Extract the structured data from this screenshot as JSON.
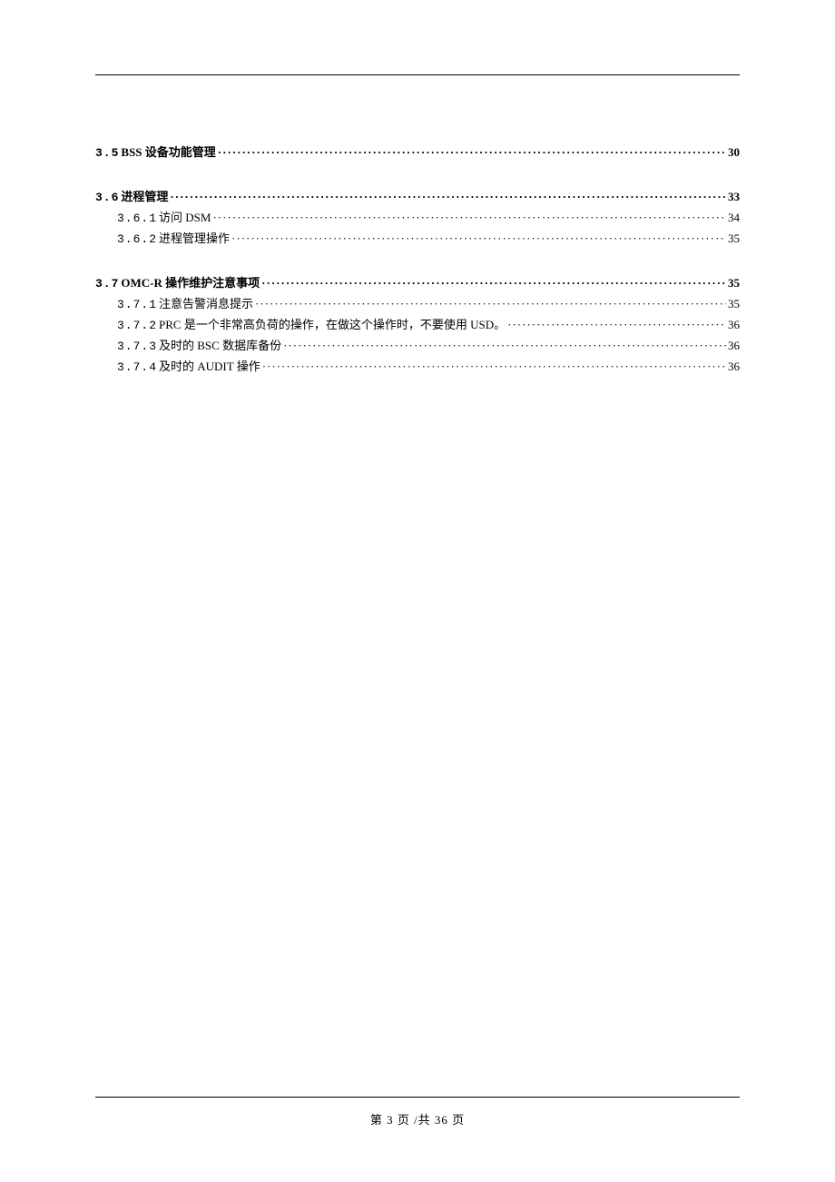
{
  "toc": {
    "sections": [
      {
        "number": "3.5",
        "title": "BSS 设备功能管理",
        "page": "30",
        "items": []
      },
      {
        "number": "3.6",
        "title": "进程管理",
        "page": "33",
        "items": [
          {
            "number": "3.6.1",
            "title": "访问 DSM",
            "page": "34"
          },
          {
            "number": "3.6.2",
            "title": " 进程管理操作",
            "page": "35"
          }
        ]
      },
      {
        "number": "3.7",
        "title": " OMC-R 操作维护注意事项",
        "page": "35",
        "items": [
          {
            "number": "3.7.1",
            "title": "注意告警消息提示",
            "page": "35"
          },
          {
            "number": "3.7.2",
            "title": " PRC 是一个非常高负荷的操作，在做这个操作时，不要使用 USD。",
            "page": "36"
          },
          {
            "number": "3.7.3",
            "title": "及时的 BSC 数据库备份",
            "page": "36"
          },
          {
            "number": "3.7.4",
            "title": "及时的 AUDIT 操作",
            "page": "36"
          }
        ]
      }
    ]
  },
  "footer": {
    "text": "第 3 页 /共 36 页"
  }
}
